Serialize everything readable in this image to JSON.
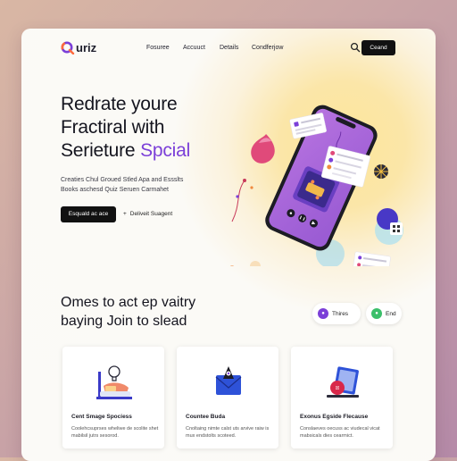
{
  "brand": {
    "name": "uriz"
  },
  "nav": {
    "links": [
      "Fosuree",
      "Accuuct",
      "Details",
      "Condferjow"
    ],
    "button": "Ceand"
  },
  "hero": {
    "title_line1": "Redrate youre",
    "title_line2": "Fractiral with",
    "title_line3_plain": "Serieture",
    "title_line3_accent": "Spcial",
    "desc_line1": "Creaties Chul Groued Stled Apa and Essslts",
    "desc_line2": "Books aschesd Quiz Seruen Carmahet",
    "cta_primary": "Esquald ac ace",
    "cta_secondary": "Deliveit Suagent"
  },
  "section": {
    "title_line1": "Omes to act ep vaitry",
    "title_line2": "baying Join to slead",
    "pills": [
      "Thires",
      "End"
    ]
  },
  "features": [
    {
      "title": "Cent Smage Spociess",
      "desc": "Coolehcsuprses wheliwe de scolite shet mabilsil jutrs sesorod."
    },
    {
      "title": "Countee Buda",
      "desc": "Cnoltaing nimte calst uts arvive raiw is mux endstolts scoteed."
    },
    {
      "title": "Exonus Egside Flecause",
      "desc": "Conslaeves oecuss ac viudecal vicat mabsicals dies cearmict."
    }
  ],
  "colors": {
    "accent": "#7b3fd8",
    "dark": "#111111",
    "glow": "#fde79a"
  },
  "icons": [
    "search-icon",
    "plus-icon",
    "lightbulb-icon",
    "envelope-icon",
    "laptop-icon"
  ]
}
